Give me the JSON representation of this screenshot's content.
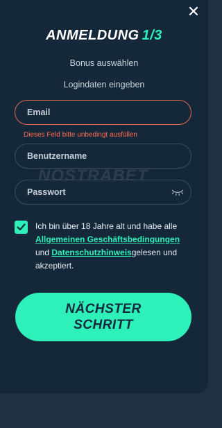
{
  "header": {
    "title": "ANMELDUNG",
    "step": "1/3"
  },
  "steps": {
    "bonus": "Bonus auswählen",
    "login": "Logindaten eingeben"
  },
  "form": {
    "email_label": "Email",
    "email_error": "Dieses Feld bitte unbedingt ausfüllen",
    "username_label": "Benutzername",
    "password_label": "Passwort"
  },
  "watermark": "NOSTRABET",
  "terms": {
    "checked": true,
    "text_1": "Ich bin über 18 Jahre alt und habe alle ",
    "link_agb": "Allgemeinen Geschäftsbedingungen",
    "text_2": " und ",
    "link_privacy": "Datenschutzhinweis",
    "text_3": "gelesen und akzeptiert."
  },
  "cta": {
    "line1": "NÄCHSTER",
    "line2": "SCHRITT"
  },
  "colors": {
    "accent": "#2ef0b9",
    "error": "#e56a4e",
    "panel": "#15283a"
  }
}
